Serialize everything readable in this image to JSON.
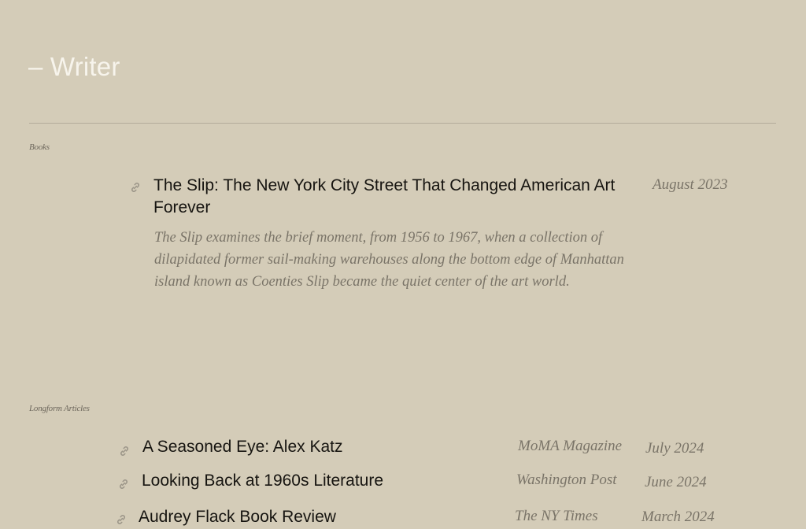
{
  "page": {
    "title": "– Writer"
  },
  "colors": {
    "background": "#d4ccb8",
    "title": "#f7f4ec",
    "text": "#161410",
    "muted": "#7a7468"
  },
  "books": {
    "label": "Books",
    "items": [
      {
        "title": "The Slip: The New York City Street That Changed American Art Forever",
        "date": "August 2023",
        "description": "The Slip examines the brief moment, from 1956 to 1967, when a collection of dilapidated former sail-making warehouses along the bottom edge of Manhattan island known as Coenties Slip became the quiet center of the art world.",
        "icon": "link-icon"
      }
    ]
  },
  "articles": {
    "label": "Longform Articles",
    "items": [
      {
        "title": "A Seasoned Eye: Alex Katz",
        "publication": "MoMA Magazine",
        "date": "July 2024",
        "icon": "link-icon"
      },
      {
        "title": "Looking Back at 1960s Literature",
        "publication": "Washington Post",
        "date": "June 2024",
        "icon": "link-icon"
      },
      {
        "title": "Audrey Flack Book Review",
        "publication": "The NY Times",
        "date": "March 2024",
        "icon": "link-icon"
      }
    ]
  }
}
